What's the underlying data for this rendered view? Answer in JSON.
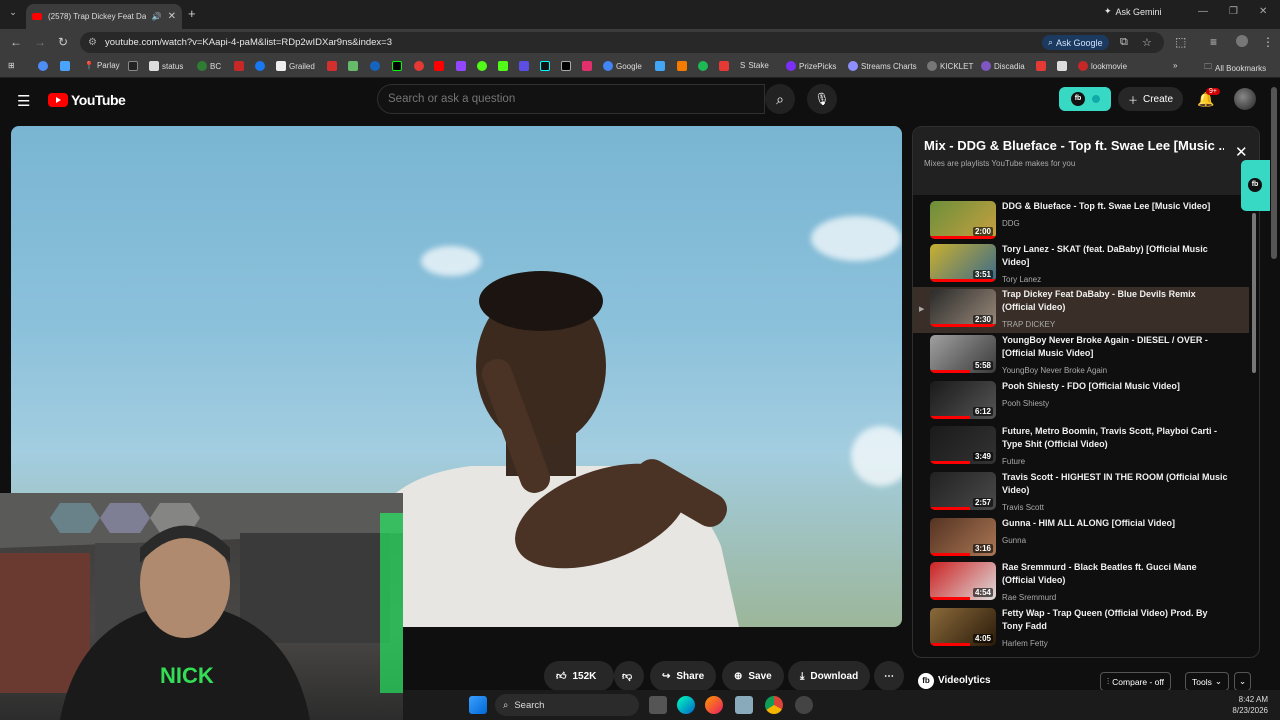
{
  "browser": {
    "tab_title": "(2578) Trap Dickey Feat Da…",
    "new_tab": "+",
    "ask_gemini": "Ask Gemini",
    "url": "youtube.com/watch?v=KAapi-4-paM&list=RDp2wIDXar9ns&index=3",
    "ask_google": "Ask Google",
    "bookmarks": [
      "Parlay",
      "status",
      "BC",
      "Grailed",
      "Google",
      "Stake",
      "PrizePicks",
      "Streams Charts",
      "KICKLET",
      "Discadia",
      "lookmovie"
    ],
    "all_bookmarks": "All Bookmarks"
  },
  "youtube": {
    "logo": "YouTube",
    "search_placeholder": "Search or ask a question",
    "create": "Create",
    "notif_badge": "9+"
  },
  "actions": {
    "likes": "152K",
    "share": "Share",
    "save": "Save",
    "download": "Download"
  },
  "panel": {
    "title": "Mix - DDG & Blueface - Top ft. Swae Lee [Music ...",
    "subtitle": "Mixes are playlists YouTube makes for you",
    "items": [
      {
        "title": "DDG & Blueface - Top ft. Swae Lee [Music Video]",
        "channel": "DDG",
        "duration": "2:00"
      },
      {
        "title": "Tory Lanez - SKAT (feat. DaBaby) [Official Music Video]",
        "channel": "Tory Lanez",
        "duration": "3:51"
      },
      {
        "title": "Trap Dickey Feat DaBaby - Blue Devils Remix (Official Video)",
        "channel": "TRAP DICKEY",
        "duration": "2:30"
      },
      {
        "title": "YoungBoy Never Broke Again - DIESEL / OVER - [Official Music Video]",
        "channel": "YoungBoy Never Broke Again",
        "duration": "5:58"
      },
      {
        "title": "Pooh Shiesty - FDO [Official Music Video]",
        "channel": "Pooh Shiesty",
        "duration": "6:12"
      },
      {
        "title": "Future, Metro Boomin, Travis Scott, Playboi Carti - Type Shit (Official Video)",
        "channel": "Future",
        "duration": "3:49"
      },
      {
        "title": "Travis Scott - HIGHEST IN THE ROOM (Official Music Video)",
        "channel": "Travis Scott",
        "duration": "2:57"
      },
      {
        "title": "Gunna - HIM ALL ALONG [Official Video]",
        "channel": "Gunna",
        "duration": "3:16"
      },
      {
        "title": "Rae Sremmurd - Black Beatles ft. Gucci Mane (Official Video)",
        "channel": "Rae Sremmurd",
        "duration": "4:54"
      },
      {
        "title": "Fetty Wap - Trap Queen (Official Video) Prod. By Tony Fadd",
        "channel": "Harlem Fetty",
        "duration": "4:05"
      }
    ],
    "active_index": 2
  },
  "videolytics": {
    "name": "Videolytics",
    "compare": "Compare - off",
    "tools": "Tools"
  },
  "taskbar": {
    "search": "Search",
    "time": "8:42 AM",
    "date": "8/23/2026"
  },
  "colors": {
    "yt_red": "#ff0000",
    "ext_teal": "#38d9c4",
    "bg": "#0f0f0f"
  }
}
